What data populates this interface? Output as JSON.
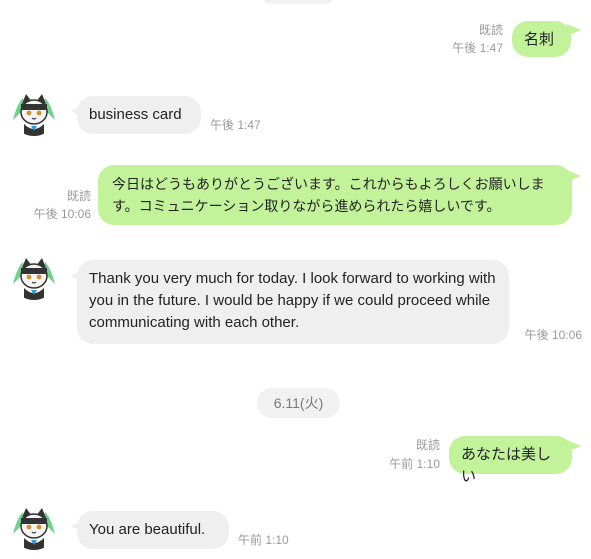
{
  "messages": [
    {
      "direction": "out",
      "text": "名刺",
      "read": "既読",
      "time": "午後 1:47"
    },
    {
      "direction": "in",
      "text": "business card",
      "time": "午後 1:47"
    },
    {
      "direction": "out",
      "text": "今日はどうもありがとうございます。これからもよろしくお願いします。コミュニケーション取りながら進められたら嬉しいです。",
      "read": "既読",
      "time": "午後 10:06"
    },
    {
      "direction": "in",
      "text": "Thank you very much for today. I look forward to working with you in the future. I would be happy if we could proceed while communicating with each other.",
      "time": "午後 10:06"
    },
    {
      "direction": "out",
      "text": "あなたは美しい",
      "read": "既読",
      "time": "午前 1:10"
    },
    {
      "direction": "in",
      "text": "You are beautiful.",
      "time": "午前 1:10"
    }
  ],
  "date_separator": "6.11(火)",
  "avatar_icon": "cat-bandit-avatar-icon",
  "colors": {
    "outgoing_bubble": "#c2f39a",
    "incoming_bubble": "#efefef",
    "meta_text": "#9a9a9a"
  }
}
